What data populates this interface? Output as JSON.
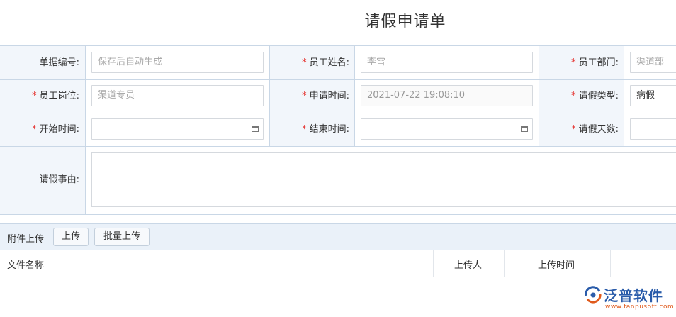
{
  "page": {
    "title": "请假申请单"
  },
  "form": {
    "doc_no": {
      "label": "单据编号:",
      "placeholder": "保存后自动生成"
    },
    "emp_name": {
      "label": "员工姓名:",
      "value": "李雪"
    },
    "emp_dept": {
      "label": "员工部门:",
      "value": "渠道部"
    },
    "emp_post": {
      "label": "员工岗位:",
      "value": "渠道专员"
    },
    "apply_time": {
      "label": "申请时间:",
      "value": "2021-07-22 19:08:10"
    },
    "leave_type": {
      "label": "请假类型:",
      "value": "病假"
    },
    "start_time": {
      "label": "开始时间:",
      "value": ""
    },
    "end_time": {
      "label": "结束时间:",
      "value": ""
    },
    "leave_days": {
      "label": "请假天数:",
      "value": ""
    },
    "reason": {
      "label": "请假事由:",
      "value": ""
    },
    "required_mark": "*"
  },
  "upload": {
    "label": "附件上传",
    "upload_btn": "上传",
    "batch_btn": "批量上传"
  },
  "table": {
    "columns": [
      "文件名称",
      "上传人",
      "上传时间"
    ]
  },
  "logo": {
    "name": "泛普软件",
    "url": "www.fanpusoft.com",
    "colors": {
      "brand": "#2a5caa",
      "accent": "#e05a1c"
    }
  },
  "colors": {
    "label_bg": "#f2f6fb",
    "border": "#c9d7e6",
    "required": "#e5302d",
    "upload_bar": "#eaf1f9"
  }
}
